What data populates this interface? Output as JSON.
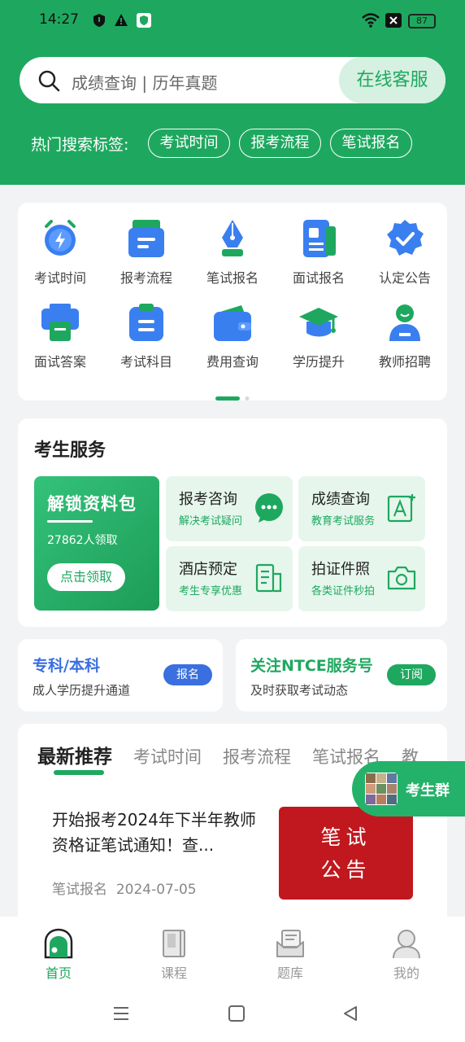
{
  "status_bar": {
    "time": "14:27",
    "battery": "87"
  },
  "search": {
    "placeholder": "成绩查询 | 历年真题",
    "service_button": "在线客服"
  },
  "hot_search": {
    "label": "热门搜索标签:",
    "tags": [
      "考试时间",
      "报考流程",
      "笔试报名"
    ]
  },
  "quick_grid": {
    "items": [
      {
        "label": "考试时间",
        "icon": "alarm-clock-icon"
      },
      {
        "label": "报考流程",
        "icon": "form-tray-icon"
      },
      {
        "label": "笔试报名",
        "icon": "pen-nib-icon"
      },
      {
        "label": "面试报名",
        "icon": "document-list-icon"
      },
      {
        "label": "认定公告",
        "icon": "verified-badge-icon"
      },
      {
        "label": "面试答案",
        "icon": "printer-icon"
      },
      {
        "label": "考试科目",
        "icon": "clipboard-icon"
      },
      {
        "label": "费用查询",
        "icon": "wallet-icon"
      },
      {
        "label": "学历提升",
        "icon": "graduation-cap-icon"
      },
      {
        "label": "教师招聘",
        "icon": "teacher-icon"
      }
    ]
  },
  "student_services": {
    "title": "考生服务",
    "promo": {
      "title": "解锁资料包",
      "count": "27862人领取",
      "button": "点击领取"
    },
    "items": [
      {
        "title": "报考咨询",
        "subtitle": "解决考试疑问",
        "icon": "chat-bubble-icon"
      },
      {
        "title": "成绩查询",
        "subtitle": "教育考试服务",
        "icon": "score-letter-icon"
      },
      {
        "title": "酒店预定",
        "subtitle": "考生专享优惠",
        "icon": "hotel-building-icon"
      },
      {
        "title": "拍证件照",
        "subtitle": "各类证件秒拍",
        "icon": "camera-icon"
      }
    ]
  },
  "promo_cards": [
    {
      "title": "专科/本科",
      "subtitle": "成人学历提升通道",
      "button": "报名",
      "color": "#3a6fe0"
    },
    {
      "title": "关注NTCE服务号",
      "subtitle": "及时获取考试动态",
      "button": "订阅",
      "color": "#1ea85f"
    }
  ],
  "news": {
    "tabs": [
      "最新推荐",
      "考试时间",
      "报考流程",
      "笔试报名",
      "教"
    ],
    "active_tab": 0,
    "item": {
      "title": "开始报考2024年下半年教师资格证笔试通知！查...",
      "category": "笔试报名",
      "date": "2024-07-05",
      "image_text_line1": "笔试",
      "image_text_line2": "公告"
    }
  },
  "float_button": {
    "label": "考生群"
  },
  "bottom_nav": [
    {
      "label": "首页",
      "icon": "home-icon",
      "active": true
    },
    {
      "label": "课程",
      "icon": "book-icon",
      "active": false
    },
    {
      "label": "题库",
      "icon": "inbox-icon",
      "active": false
    },
    {
      "label": "我的",
      "icon": "user-icon",
      "active": false
    }
  ],
  "colors": {
    "primary": "#1ea85f",
    "light": "#e6f6ec",
    "blue": "#3a6fe0",
    "red": "#c0181e"
  }
}
